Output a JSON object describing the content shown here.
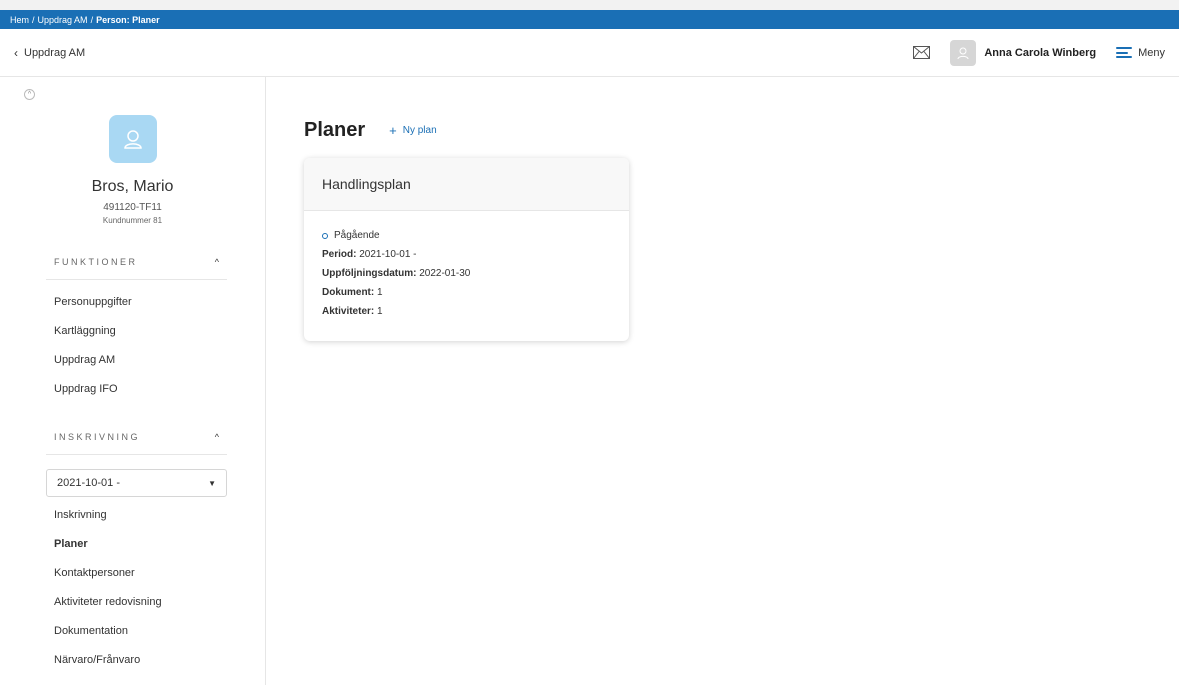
{
  "breadcrumb": {
    "items": [
      "Hem",
      "Uppdrag AM",
      "Person: Planer"
    ],
    "separator": "/"
  },
  "header": {
    "back_label": "Uppdrag AM",
    "user_name": "Anna Carola Winberg",
    "menu_label": "Meny"
  },
  "profile": {
    "name": "Bros, Mario",
    "id": "491120-TF11",
    "customer_number": "Kundnummer 81"
  },
  "sidebar": {
    "functions": {
      "title": "FUNKTIONER",
      "items": [
        "Personuppgifter",
        "Kartläggning",
        "Uppdrag AM",
        "Uppdrag IFO"
      ]
    },
    "enrollment": {
      "title": "INSKRIVNING",
      "selected_period": "2021-10-01 -",
      "items": [
        "Inskrivning",
        "Planer",
        "Kontaktpersoner",
        "Aktiviteter redovisning",
        "Dokumentation",
        "Närvaro/Frånvaro"
      ],
      "active_item": "Planer"
    }
  },
  "main": {
    "title": "Planer",
    "new_plan_label": "Ny plan",
    "plans": [
      {
        "title": "Handlingsplan",
        "status": "Pågående",
        "period_label": "Period:",
        "period_value": "2021-10-01 -",
        "followup_label": "Uppföljningsdatum:",
        "followup_value": "2022-01-30",
        "documents_label": "Dokument:",
        "documents_value": "1",
        "activities_label": "Aktiviteter:",
        "activities_value": "1"
      }
    ]
  },
  "colors": {
    "accent": "#1a6fb5",
    "avatar_bg": "#a9d8f3"
  }
}
